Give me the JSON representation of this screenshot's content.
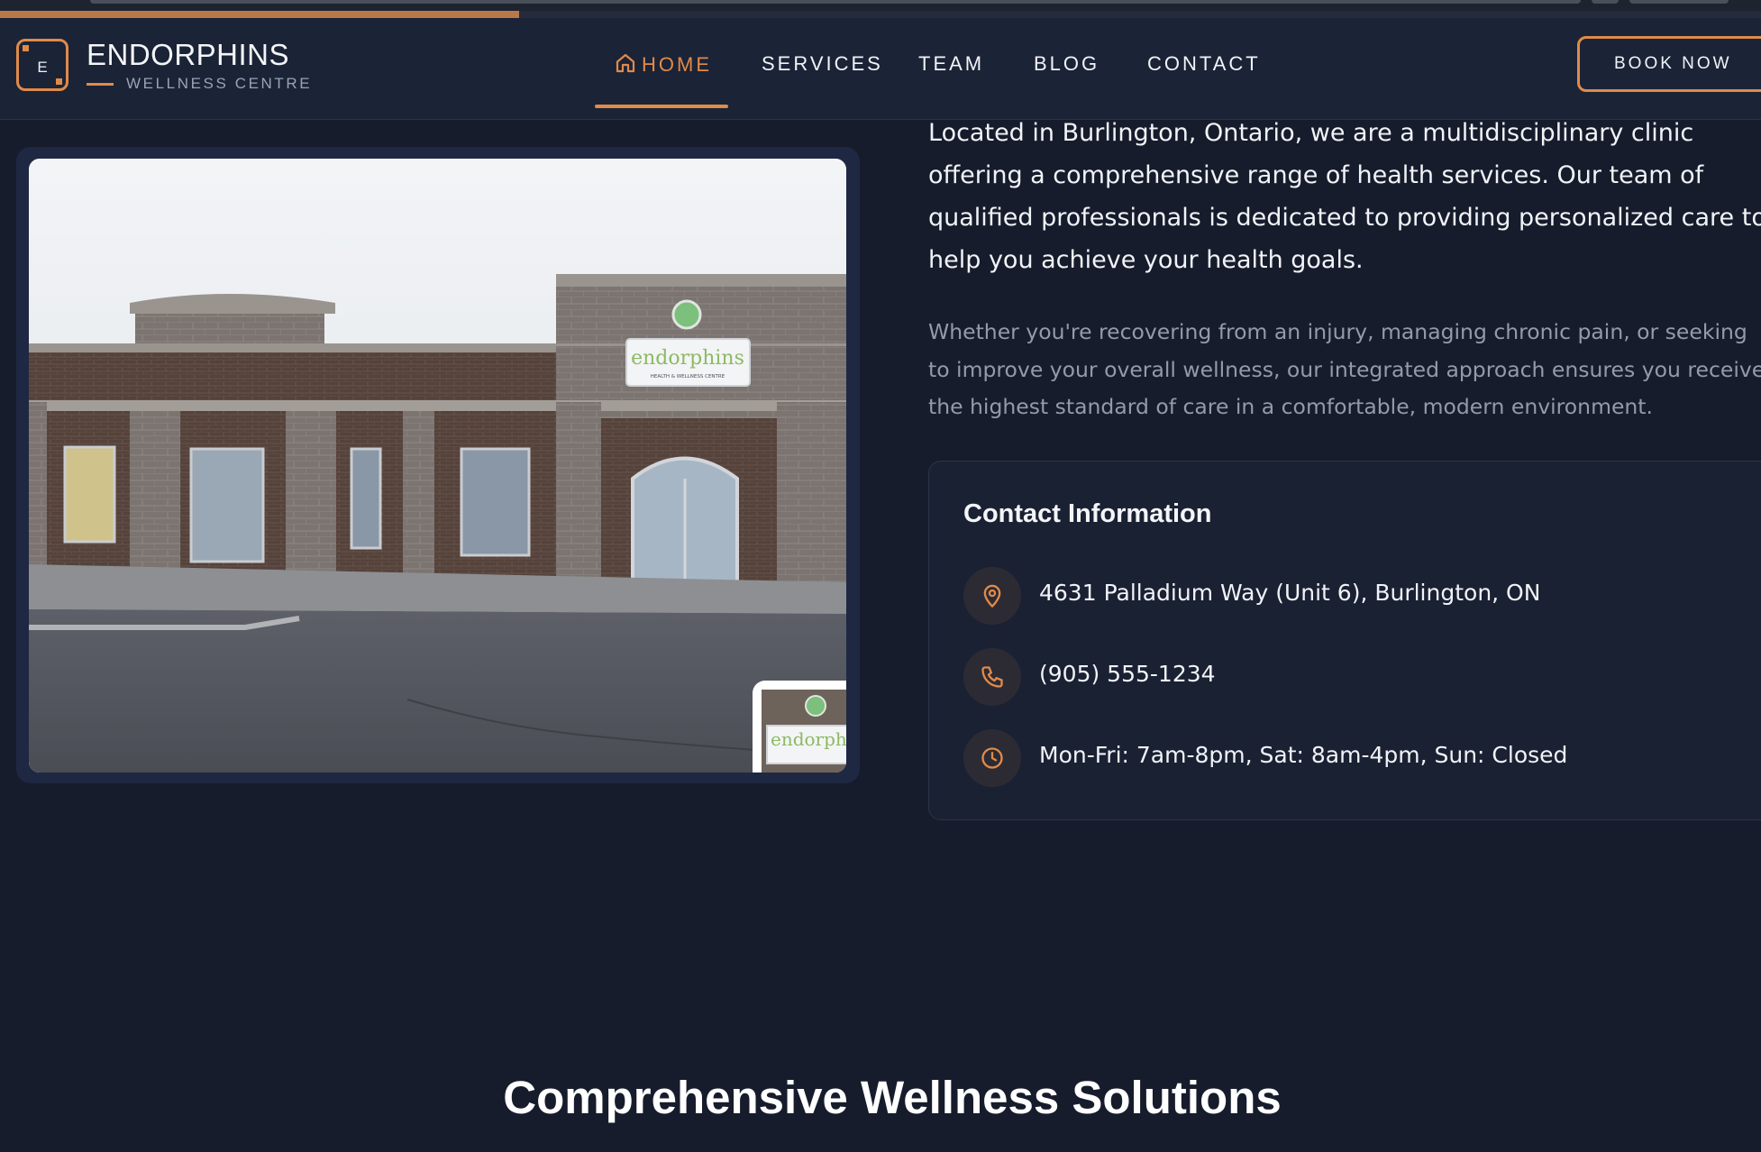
{
  "progress": {
    "fraction": 0.295,
    "color": "#b9784a"
  },
  "brand": {
    "logo_letter": "E",
    "name": "ENDORPHINS",
    "subtitle": "WELLNESS CENTRE",
    "accent": "#e08a4a"
  },
  "nav": {
    "items": [
      {
        "label": "HOME",
        "icon": "home-icon",
        "active": true
      },
      {
        "label": "SERVICES",
        "active": false
      },
      {
        "label": "TEAM",
        "active": false
      },
      {
        "label": "BLOG",
        "active": false
      },
      {
        "label": "CONTACT",
        "active": false
      }
    ],
    "cta": "BOOK NOW"
  },
  "about": {
    "paragraph1": "Located in Burlington, Ontario, we are a multidisciplinary clinic offering a comprehensive range of health services. Our team of qualified professionals is dedicated to providing personalized care to help you achieve your health goals.",
    "paragraph2": "Whether you're recovering from an injury, managing chronic pain, or seeking to improve your overall wellness, our integrated approach ensures you receive the highest standard of care in a comfortable, modern environment."
  },
  "photo": {
    "sign_text": "endorphins",
    "sign_subtext": "HEALTH & WELLNESS CENTRE",
    "thumb_sign_text": "endorphins"
  },
  "contact": {
    "title": "Contact Information",
    "items": [
      {
        "icon": "map-pin-icon",
        "text": "4631 Palladium Way (Unit 6), Burlington, ON"
      },
      {
        "icon": "phone-icon",
        "text": "(905) 555-1234"
      },
      {
        "icon": "clock-icon",
        "text": "Mon-Fri: 7am-8pm, Sat: 8am-4pm, Sun: Closed"
      }
    ]
  },
  "section": {
    "heading": "Comprehensive Wellness Solutions"
  },
  "colors": {
    "background": "#161c2c",
    "navbar": "#1b2336",
    "accent": "#e08a4a",
    "muted_text": "#939bab"
  }
}
